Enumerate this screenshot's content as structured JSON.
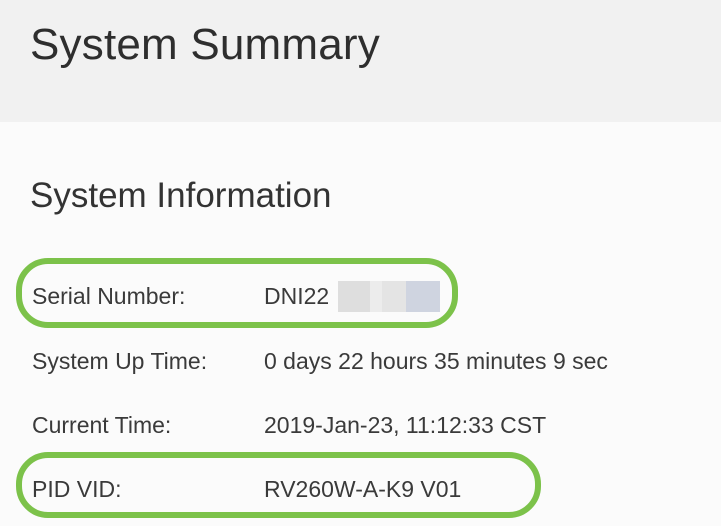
{
  "header": {
    "title": "System Summary"
  },
  "system_information": {
    "title": "System Information",
    "rows": [
      {
        "label": "Serial Number:",
        "value": "DNI22"
      },
      {
        "label": "System Up Time:",
        "value": "0 days 22 hours 35 minutes 9 sec"
      },
      {
        "label": "Current Time:",
        "value": "2019-Jan-23, 11:12:33 CST"
      },
      {
        "label": "PID VID:",
        "value": "RV260W-A-K9 V01"
      }
    ]
  },
  "colors": {
    "highlight": "#7cc24a",
    "header_background": "#f1f1f1"
  }
}
